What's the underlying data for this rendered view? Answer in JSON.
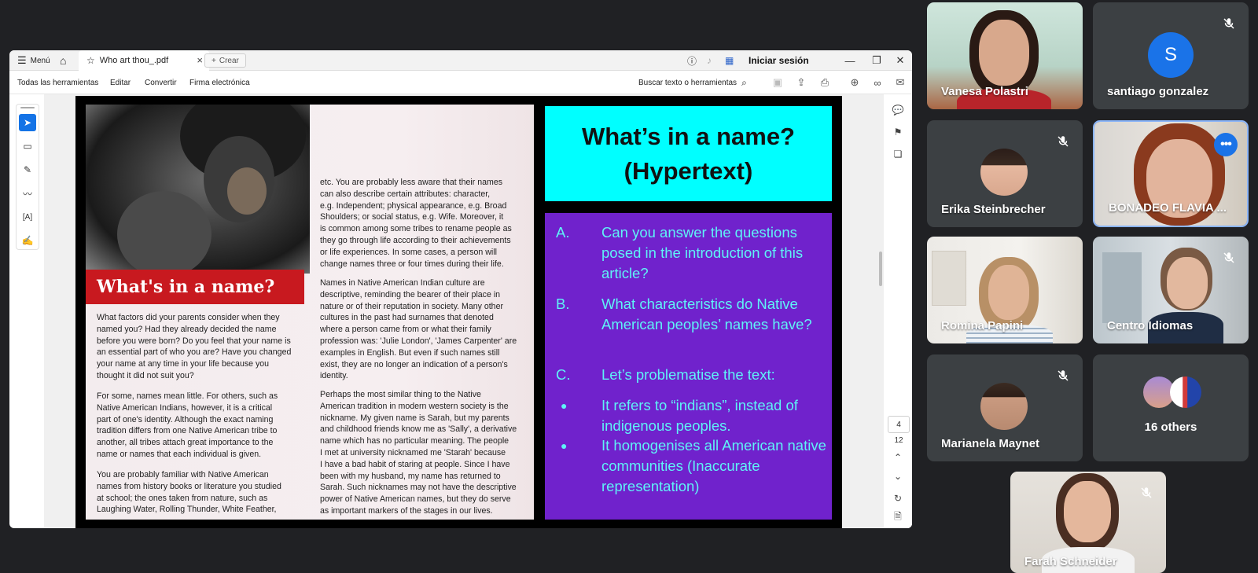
{
  "pdf_app": {
    "titlebar": {
      "menu_label": "Menú",
      "tab_title": "Who art thou_.pdf",
      "new_tab_label": "Crear",
      "signin_label": "Iniciar sesión"
    },
    "toolbar": {
      "menu_items": [
        "Todas las herramientas",
        "Editar",
        "Convertir",
        "Firma electrónica"
      ],
      "search_label": "Buscar texto o herramientas"
    },
    "page_nav": {
      "current": "4",
      "total": "12"
    }
  },
  "magazine": {
    "heading": "What's in a name?",
    "col1_para1": "What factors did your parents consider when they\nnamed you? Had they already decided the name\nbefore you were born? Do you feel that your name is\nan essential part of who you are?  Have you changed\nyour name at any time in your life because you\nthought it did not suit you?",
    "col1_para2": "For some, names mean little. For others, such as\nNative American Indians, however, it is a critical\npart of one's identity. Although the exact naming\ntradition differs from one Native American tribe to\nanother, all tribes attach great importance to the\nname or names that each individual is given.",
    "col1_para3": "You are probably familiar with Native American\nnames from history books or literature you studied\nat school; the ones taken from nature, such as\nLaughing Water, Rolling Thunder, White Feather,",
    "col2_para1": "etc. You are probably less aware that their names\ncan also describe certain attributes: character,\ne.g. Independent; physical appearance, e.g. Broad\nShoulders; or social status, e.g. Wife. Moreover, it\nis common among some tribes to rename people as\nthey go through life according to their achievements\nor life experiences. In some cases, a person will\nchange names three or four times during their life.",
    "col2_para2": "Names in Native American Indian culture are\ndescriptive, reminding the bearer of their place in\nnature or of their reputation in society. Many other\ncultures in the past had surnames that denoted\nwhere a person came from or what their family\nprofession was: 'Julie London', 'James Carpenter' are\nexamples in English. But even if such names still\nexist, they are no longer an indication of a person's\nidentity.",
    "col2_para3": "Perhaps the most similar thing to the Native\nAmerican tradition in modern western society is the\nnickname. My given name is Sarah, but my parents\nand childhood friends know me as 'Sally', a derivative\nname which has no particular meaning. The people\nI met at university nicknamed me 'Starah' because\nI have a bad habit of staring at people. Since I have\nbeen with my husband, my name has returned to\nSarah. Such nicknames may not have the descriptive\npower of Native American names, but they do serve\nas important markers of the stages in our lives."
  },
  "slide": {
    "title_line1": "What’s in a name?",
    "title_line2": "(Hypertext)",
    "items": [
      {
        "label": "A.",
        "text": "Can you answer the questions posed in the introduction of this article?"
      },
      {
        "label": "B.",
        "text": "What characteristics do Native American peoples’ names have?"
      },
      {
        "label": "C.",
        "text": "Let’s problematise the text:"
      },
      {
        "label": "●",
        "text": "It refers to “indians”, instead of indigenous peoples."
      },
      {
        "label": "●",
        "text": "It homogenises all American native communities (Inaccurate representation)"
      }
    ]
  },
  "participants": [
    {
      "name": "Vanesa Polastri",
      "muted": false,
      "type": "video"
    },
    {
      "name": "santiago gonzalez",
      "muted": true,
      "type": "initial",
      "initial": "S",
      "avatar_color": "#1a73e8"
    },
    {
      "name": "Erika Steinbrecher",
      "muted": true,
      "type": "photo"
    },
    {
      "name": "BONADEO FLAVIA ...",
      "muted": false,
      "type": "video",
      "active": true
    },
    {
      "name": "Romina Papini",
      "muted": false,
      "type": "video"
    },
    {
      "name": "Centro Idiomas",
      "muted": true,
      "type": "video"
    },
    {
      "name": "Marianela Maynet",
      "muted": true,
      "type": "photo"
    },
    {
      "name": "16 others",
      "muted": false,
      "type": "others"
    },
    {
      "name": "Farah Schneider",
      "muted": true,
      "type": "video"
    }
  ],
  "colors": {
    "meet_bg": "#202124",
    "tile_bg": "#3c4043",
    "slide_title_bg": "#00ffff",
    "slide_body_bg": "#7022cc",
    "slide_body_text": "#5ff3f6",
    "magazine_banner": "#c8191f",
    "active_border": "#8ab4f8"
  }
}
